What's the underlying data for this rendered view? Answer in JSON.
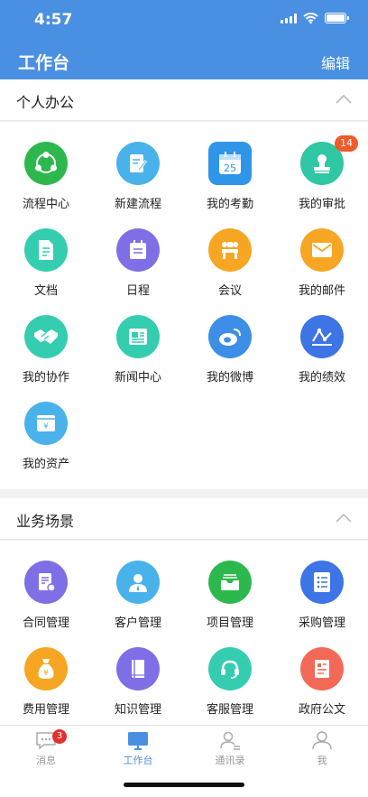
{
  "status": {
    "time": "4:57"
  },
  "header": {
    "title": "工作台",
    "edit_label": "编辑"
  },
  "colors": {
    "primary": "#4a90e2",
    "badge": "#f25a2a",
    "tab_badge": "#e0312d"
  },
  "personal": {
    "title": "个人办公",
    "apps": [
      {
        "label": "流程中心",
        "icon": "share-icon",
        "color": "#2db84d"
      },
      {
        "label": "新建流程",
        "icon": "edit-doc-icon",
        "color": "#4ab2ea"
      },
      {
        "label": "我的考勤",
        "icon": "calendar-icon",
        "color": "#2f95e8",
        "calendar_day": "25"
      },
      {
        "label": "我的审批",
        "icon": "stamp-icon",
        "color": "#2fc7a4",
        "badge": "14"
      },
      {
        "label": "文档",
        "icon": "document-icon",
        "color": "#35cdb0"
      },
      {
        "label": "日程",
        "icon": "schedule-icon",
        "color": "#7e6fe6"
      },
      {
        "label": "会议",
        "icon": "meeting-icon",
        "color": "#f6a623"
      },
      {
        "label": "我的邮件",
        "icon": "mail-icon",
        "color": "#f6a623"
      },
      {
        "label": "我的协作",
        "icon": "handshake-icon",
        "color": "#35cdb0"
      },
      {
        "label": "新闻中心",
        "icon": "news-icon",
        "color": "#35cdb0"
      },
      {
        "label": "我的微博",
        "icon": "weibo-icon",
        "color": "#3d8ee6"
      },
      {
        "label": "我的绩效",
        "icon": "performance-icon",
        "color": "#3d74e6"
      },
      {
        "label": "我的资产",
        "icon": "asset-icon",
        "color": "#4ab2ea"
      }
    ]
  },
  "business": {
    "title": "业务场景",
    "apps": [
      {
        "label": "合同管理",
        "icon": "contract-icon",
        "color": "#7e6fe6"
      },
      {
        "label": "客户管理",
        "icon": "customer-icon",
        "color": "#4ab2ea"
      },
      {
        "label": "项目管理",
        "icon": "project-icon",
        "color": "#2db84d"
      },
      {
        "label": "采购管理",
        "icon": "purchase-icon",
        "color": "#3d74e6"
      },
      {
        "label": "费用管理",
        "icon": "money-bag-icon",
        "color": "#f6a623"
      },
      {
        "label": "知识管理",
        "icon": "book-icon",
        "color": "#7e6fe6"
      },
      {
        "label": "客服管理",
        "icon": "headset-icon",
        "color": "#35cdb0"
      },
      {
        "label": "政府公文",
        "icon": "official-doc-icon",
        "color": "#f26a57"
      }
    ]
  },
  "tabbar": {
    "items": [
      {
        "label": "消息",
        "icon": "message-icon",
        "badge": "3"
      },
      {
        "label": "工作台",
        "icon": "workbench-icon",
        "active": true
      },
      {
        "label": "通讯录",
        "icon": "contacts-icon"
      },
      {
        "label": "我",
        "icon": "profile-icon"
      }
    ]
  }
}
